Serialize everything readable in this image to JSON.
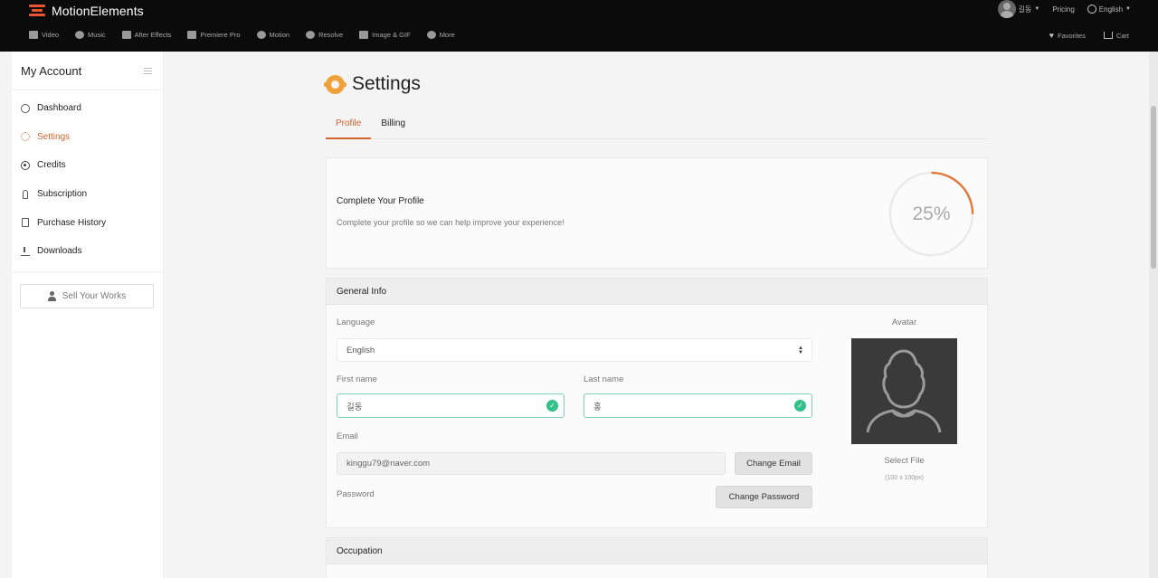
{
  "header": {
    "logo_text": "MotionElements",
    "user_name": "길동",
    "pricing_label": "Pricing",
    "language_label": "English",
    "nav": [
      {
        "label": "Video",
        "icon": "video-icon"
      },
      {
        "label": "Music",
        "icon": "music-icon"
      },
      {
        "label": "After Effects",
        "icon": "after-effects-icon"
      },
      {
        "label": "Premiere Pro",
        "icon": "premiere-pro-icon"
      },
      {
        "label": "Motion",
        "icon": "motion-icon"
      },
      {
        "label": "Resolve",
        "icon": "resolve-icon"
      },
      {
        "label": "Image & GIF",
        "icon": "image-icon"
      },
      {
        "label": "More",
        "icon": "more-icon"
      }
    ],
    "favorites_label": "Favorites",
    "cart_label": "Cart"
  },
  "sidebar": {
    "title": "My Account",
    "items": [
      {
        "label": "Dashboard",
        "icon": "dashboard-icon",
        "active": false
      },
      {
        "label": "Settings",
        "icon": "gear-icon",
        "active": true
      },
      {
        "label": "Credits",
        "icon": "credits-icon",
        "active": false
      },
      {
        "label": "Subscription",
        "icon": "subscription-icon",
        "active": false
      },
      {
        "label": "Purchase History",
        "icon": "receipt-icon",
        "active": false
      },
      {
        "label": "Downloads",
        "icon": "download-icon",
        "active": false
      }
    ],
    "sell_label": "Sell Your Works"
  },
  "main": {
    "title": "Settings",
    "tabs": [
      {
        "label": "Profile",
        "active": true
      },
      {
        "label": "Billing",
        "active": false
      }
    ],
    "profile_completion": {
      "title": "Complete Your Profile",
      "subtitle": "Complete your profile so we can help improve your experience!",
      "percent_label": "25%",
      "percent": 25
    },
    "general_info": {
      "heading": "General Info",
      "language_label": "Language",
      "language_value": "English",
      "first_name_label": "First name",
      "first_name_value": "길동",
      "last_name_label": "Last name",
      "last_name_value": "홍",
      "email_label": "Email",
      "email_value": "kinggu79@naver.com",
      "change_email_label": "Change Email",
      "password_label": "Password",
      "change_password_label": "Change Password",
      "avatar_label": "Avatar",
      "select_file_label": "Select File",
      "file_hint": "(100 x 100px)"
    },
    "occupation_heading": "Occupation"
  },
  "colors": {
    "accent": "#d2652c",
    "valid": "#33c08b",
    "header_bg": "#0b0b0b"
  }
}
